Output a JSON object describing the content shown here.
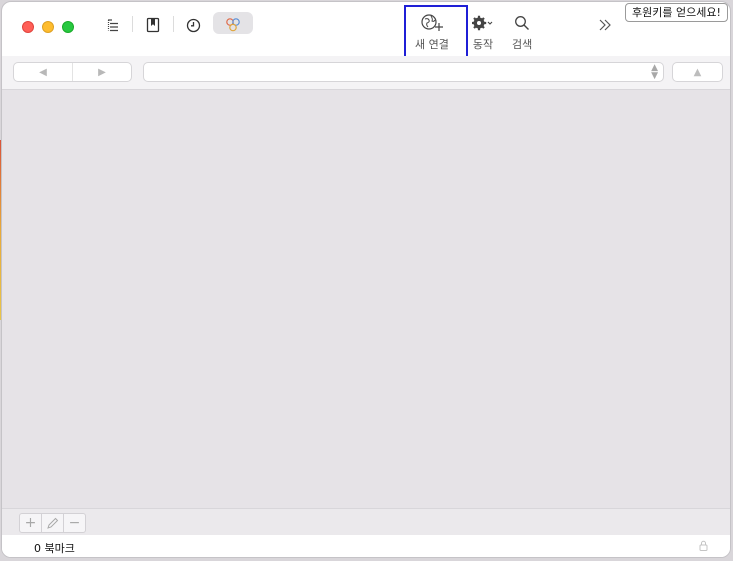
{
  "toolbar": {
    "icons": [
      "outline-view-icon",
      "bookmarks-icon",
      "history-icon",
      "bonjour-icon"
    ],
    "new_connection_label": "새 연결",
    "action_label": "동작",
    "search_label": "검색",
    "donate_label": "후원키를 얻으세요!"
  },
  "path_bar": {
    "back_icon": "back-arrow-icon",
    "forward_icon": "forward-arrow-icon",
    "path_value": "",
    "up_icon": "up-arrow-icon"
  },
  "bottom_bar": {
    "add_icon": "plus-icon",
    "edit_icon": "pencil-icon",
    "remove_icon": "minus-icon"
  },
  "status": {
    "text": "0 북마크",
    "lock_icon": "lock-icon"
  },
  "colors": {
    "highlight": "#1f1fd6",
    "content_bg": "#e6e3e7"
  }
}
